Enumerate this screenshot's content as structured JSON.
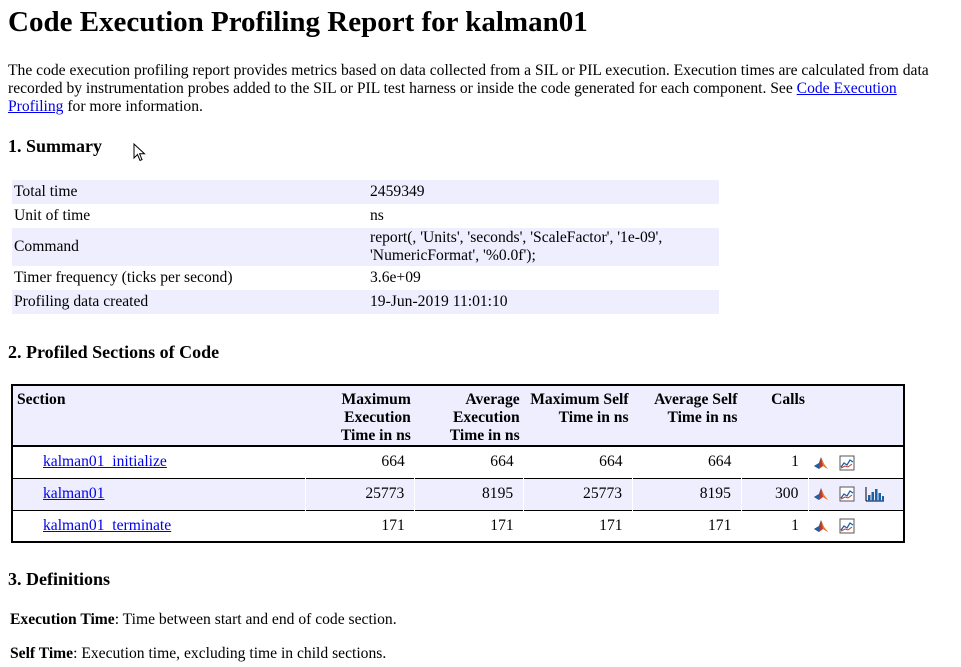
{
  "report": {
    "title": "Code Execution Profiling Report for kalman01",
    "intro_text": "The code execution profiling report provides metrics based on data collected from a SIL or PIL execution. Execution times are calculated from data recorded by instrumentation probes added to the SIL or PIL test harness or inside the code generated for each component. See ",
    "intro_link": "Code Execution Profiling",
    "intro_tail": " for more information."
  },
  "summary": {
    "heading": "1. Summary",
    "rows": [
      {
        "label": "Total time",
        "value": "2459349"
      },
      {
        "label": "Unit of time",
        "value": "ns"
      },
      {
        "label": "Command",
        "value": "report(, 'Units', 'seconds', 'ScaleFactor', '1e-09', 'NumericFormat', '%0.0f');"
      },
      {
        "label": "Timer frequency (ticks per second)",
        "value": "3.6e+09"
      },
      {
        "label": "Profiling data created",
        "value": "19-Jun-2019 11:01:10"
      }
    ]
  },
  "sections": {
    "heading": "2. Profiled Sections of Code",
    "columns": [
      "Section",
      "Maximum Execution Time in ns",
      "Average Execution Time in ns",
      "Maximum Self Time in ns",
      "Average Self Time in ns",
      "Calls"
    ],
    "rows": [
      {
        "name": "kalman01_initialize",
        "max_exec": "664",
        "avg_exec": "664",
        "max_self": "664",
        "avg_self": "664",
        "calls": "1"
      },
      {
        "name": "kalman01",
        "max_exec": "25773",
        "avg_exec": "8195",
        "max_self": "25773",
        "avg_self": "8195",
        "calls": "300"
      },
      {
        "name": "kalman01_terminate",
        "max_exec": "171",
        "avg_exec": "171",
        "max_self": "171",
        "avg_self": "171",
        "calls": "1"
      }
    ],
    "icons": [
      "matlab-icon",
      "plot-icon",
      "histogram-icon"
    ]
  },
  "definitions": {
    "heading": "3. Definitions",
    "items": [
      {
        "term": "Execution Time",
        "text": ": Time between start and end of code section."
      },
      {
        "term": "Self Time",
        "text": ": Execution time, excluding time in child sections."
      }
    ]
  },
  "colors": {
    "row_shade": "#eeeeff",
    "link": "#0000ee"
  }
}
